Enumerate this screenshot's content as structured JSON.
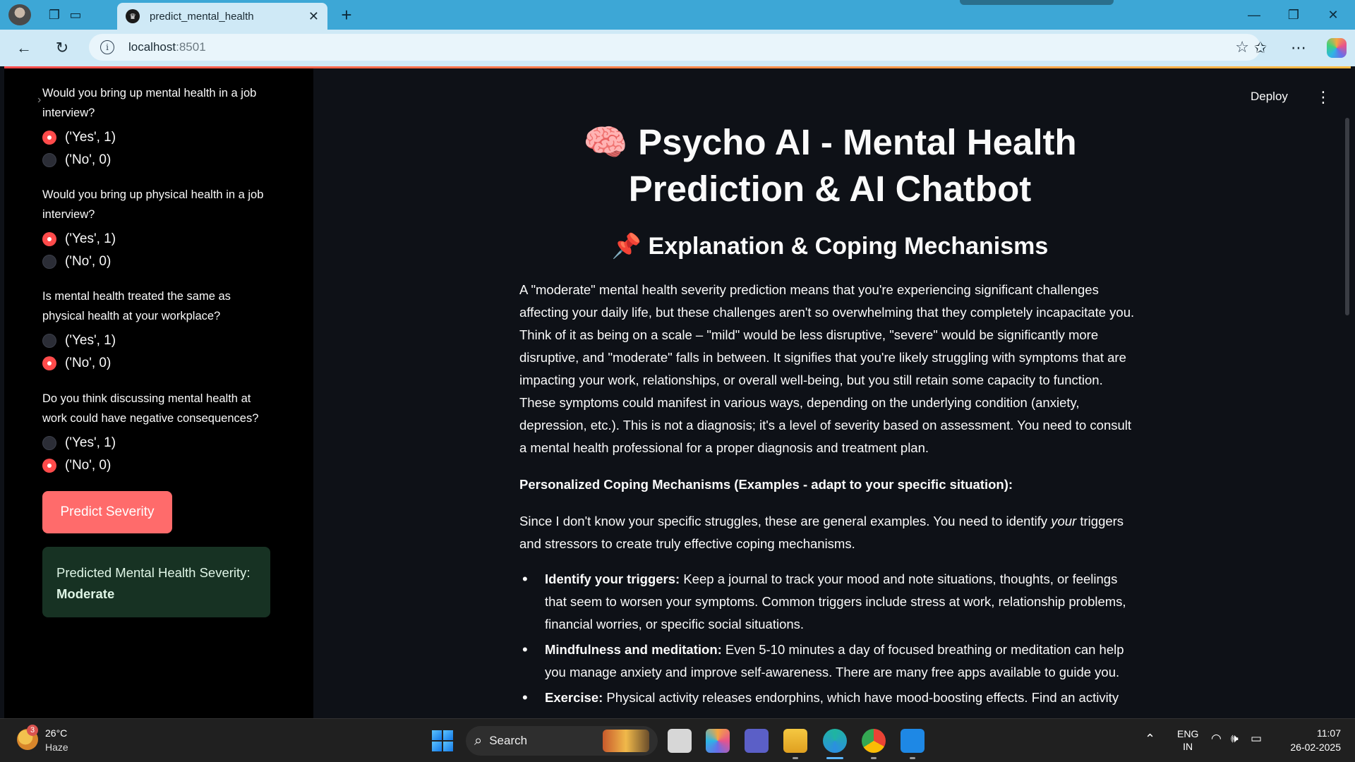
{
  "browser": {
    "tab_title": "predict_mental_health",
    "url_host": "localhost",
    "url_port": ":8501"
  },
  "sidebar": {
    "questions": [
      {
        "text": "Would you bring up mental health in a job interview?",
        "options": [
          "('Yes', 1)",
          "('No', 0)"
        ],
        "selected": 0
      },
      {
        "text": "Would you bring up physical health in a job interview?",
        "options": [
          "('Yes', 1)",
          "('No', 0)"
        ],
        "selected": 0
      },
      {
        "text": "Is mental health treated the same as physical health at your workplace?",
        "options": [
          "('Yes', 1)",
          "('No', 0)"
        ],
        "selected": 1
      },
      {
        "text": "Do you think discussing mental health at work could have negative consequences?",
        "options": [
          "('Yes', 1)",
          "('No', 0)"
        ],
        "selected": 1
      }
    ],
    "predict_button": "Predict Severity",
    "result_label": "Predicted Mental Health Severity:",
    "result_value": "Moderate"
  },
  "header": {
    "deploy_label": "Deploy"
  },
  "main": {
    "title_emoji": "🧠",
    "title": "Psycho AI - Mental Health Prediction & AI Chatbot",
    "section_emoji": "📌",
    "section_title": "Explanation & Coping Mechanisms",
    "para1": "A \"moderate\" mental health severity prediction means that you're experiencing significant challenges affecting your daily life, but these challenges aren't so overwhelming that they completely incapacitate you. Think of it as being on a scale – \"mild\" would be less disruptive, \"severe\" would be significantly more disruptive, and \"moderate\" falls in between. It signifies that you're likely struggling with symptoms that are impacting your work, relationships, or overall well-being, but you still retain some capacity to function. These symptoms could manifest in various ways, depending on the underlying condition (anxiety, depression, etc.). This is not a diagnosis; it's a level of severity based on assessment. You need to consult a mental health professional for a proper diagnosis and treatment plan.",
    "coping_heading": "Personalized Coping Mechanisms (Examples - adapt to your specific situation):",
    "para2_a": "Since I don't know your specific struggles, these are general examples. You need to identify ",
    "para2_em": "your",
    "para2_b": " triggers and stressors to create truly effective coping mechanisms.",
    "bullets": [
      {
        "label": "Identify your triggers:",
        "text": " Keep a journal to track your mood and note situations, thoughts, or feelings that seem to worsen your symptoms. Common triggers include stress at work, relationship problems, financial worries, or specific social situations."
      },
      {
        "label": "Mindfulness and meditation:",
        "text": " Even 5-10 minutes a day of focused breathing or meditation can help you manage anxiety and improve self-awareness. There are many free apps available to guide you."
      },
      {
        "label": "Exercise:",
        "text": " Physical activity releases endorphins, which have mood-boosting effects. Find an activity"
      }
    ]
  },
  "taskbar": {
    "weather_badge": "3",
    "temperature": "26°C",
    "weather": "Haze",
    "search_label": "Search",
    "lang_line1": "ENG",
    "lang_line2": "IN",
    "time": "11:07",
    "date": "26-02-2025"
  }
}
